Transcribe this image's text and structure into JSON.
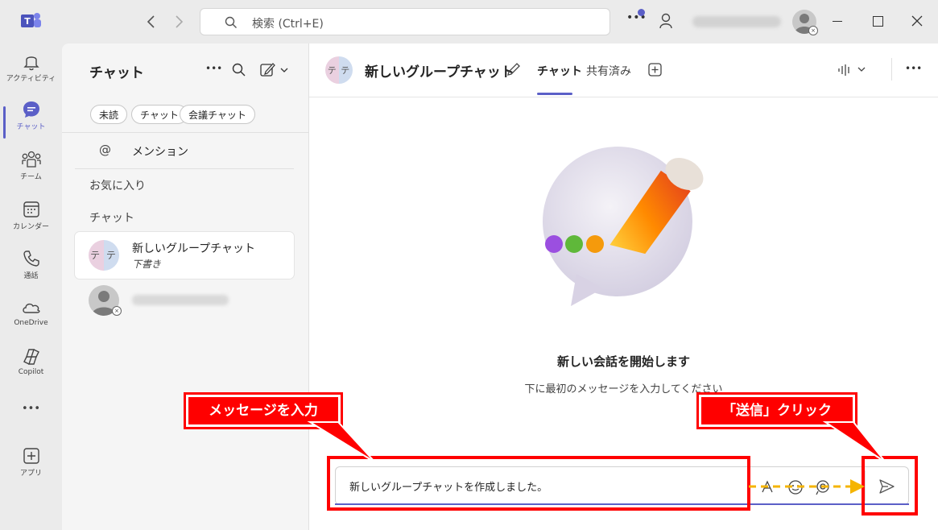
{
  "search": {
    "placeholder": "検索 (Ctrl+E)"
  },
  "rail": [
    {
      "label": "アクティビティ",
      "icon": "bell-icon"
    },
    {
      "label": "チャット",
      "icon": "chat-icon"
    },
    {
      "label": "チーム",
      "icon": "teams-icon"
    },
    {
      "label": "カレンダー",
      "icon": "calendar-icon"
    },
    {
      "label": "通話",
      "icon": "phone-icon"
    },
    {
      "label": "OneDrive",
      "icon": "cloud-icon"
    },
    {
      "label": "Copilot",
      "icon": "copilot-icon"
    },
    {
      "label": "アプリ",
      "icon": "plus-square-icon"
    }
  ],
  "rail_more": "•••",
  "list": {
    "title": "チャット",
    "filters": [
      "未読",
      "チャット",
      "会議チャット"
    ],
    "mention": "メンション",
    "favorites": "お気に入り",
    "chats_section": "チャット",
    "items": [
      {
        "avatar_text": "テ テ",
        "name": "新しいグループチャット",
        "sub": "下書き"
      }
    ]
  },
  "header": {
    "avatar_text": "テ テ",
    "title": "新しいグループチャット",
    "tabs": [
      "チャット",
      "共有済み"
    ]
  },
  "empty": {
    "title": "新しい会話を開始します",
    "subtitle": "下に最初のメッセージを入力してください"
  },
  "compose": {
    "value": "新しいグループチャットを作成しました。"
  },
  "annotations": {
    "input_label": "メッセージを入力",
    "send_label": "「送信」クリック"
  },
  "colors": {
    "accent": "#5b5fc7",
    "annotation": "#ff0000",
    "arrow": "#f5b400"
  }
}
